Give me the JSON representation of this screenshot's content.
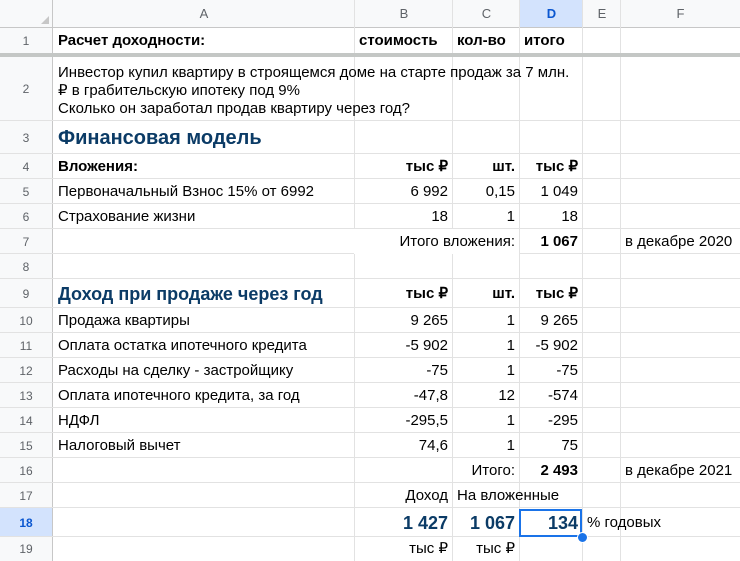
{
  "columns": [
    "A",
    "B",
    "C",
    "D",
    "E",
    "F"
  ],
  "selected_column": "D",
  "rows": [
    "1",
    "2",
    "3",
    "4",
    "5",
    "6",
    "7",
    "8",
    "9",
    "10",
    "11",
    "12",
    "13",
    "14",
    "15",
    "16",
    "17",
    "18",
    "19"
  ],
  "selected_row": "18",
  "r1": {
    "a": "Расчет доходности:",
    "b": "стоимость",
    "c": "кол-во",
    "d": "итого"
  },
  "r2": {
    "a": "Инвестор купил квартиру в строящемся доме на старте продаж за 7 млн. ₽ в грабительскую ипотеку под 9%\nСколько он заработал продав квартиру через год?"
  },
  "r3": {
    "a": "Финансовая модель"
  },
  "r4": {
    "a": "Вложения:",
    "b": "тыс ₽",
    "c": "шт.",
    "d": "тыс ₽"
  },
  "r5": {
    "a": "Первоначальный Взнос 15% от 6992",
    "b": "6 992",
    "c": "0,15",
    "d": "1 049"
  },
  "r6": {
    "a": "Страхование жизни",
    "b": "18",
    "c": "1",
    "d": "18"
  },
  "r7": {
    "label": "Итого вложения:",
    "d": "1 067",
    "f": "в декабре 2020"
  },
  "r9": {
    "a": "Доход при продаже через год",
    "b": "тыс ₽",
    "c": "шт.",
    "d": "тыс ₽"
  },
  "r10": {
    "a": "Продажа квартиры",
    "b": "9 265",
    "c": "1",
    "d": "9 265"
  },
  "r11": {
    "a": "Оплата остатка ипотечного кредита",
    "b": "-5 902",
    "c": "1",
    "d": "-5 902"
  },
  "r12": {
    "a": "Расходы на сделку - застройщику",
    "b": "-75",
    "c": "1",
    "d": "-75"
  },
  "r13": {
    "a": "Оплата ипотечного кредита, за год",
    "b": "-47,8",
    "c": "12",
    "d": "-574"
  },
  "r14": {
    "a": "НДФЛ",
    "b": "-295,5",
    "c": "1",
    "d": "-295"
  },
  "r15": {
    "a": "Налоговый вычет",
    "b": "74,6",
    "c": "1",
    "d": "75"
  },
  "r16": {
    "label": "Итого:",
    "d": "2 493",
    "f": "в декабре 2021"
  },
  "r17": {
    "b": "Доход",
    "c": "На вложенные"
  },
  "r18": {
    "b": "1 427",
    "c": "1 067",
    "d": "134",
    "e": "% годовых"
  },
  "r19": {
    "b": "тыс ₽",
    "c": "тыс ₽"
  }
}
